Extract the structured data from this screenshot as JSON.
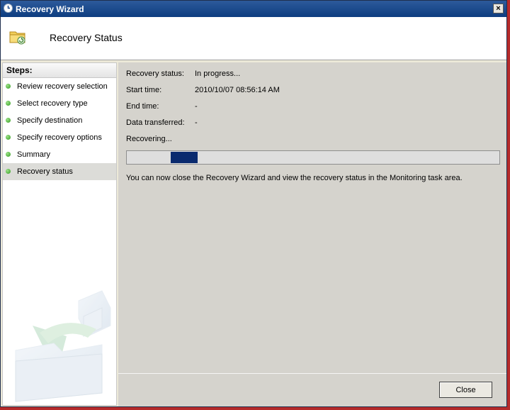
{
  "window": {
    "title": "Recovery Wizard",
    "close_glyph": "×"
  },
  "header": {
    "title": "Recovery Status",
    "icon": "folder-restore-icon"
  },
  "sidebar": {
    "heading": "Steps:",
    "items": [
      {
        "label": "Review recovery selection",
        "status": "complete"
      },
      {
        "label": "Select recovery type",
        "status": "complete"
      },
      {
        "label": "Specify destination",
        "status": "complete"
      },
      {
        "label": "Specify recovery options",
        "status": "complete"
      },
      {
        "label": "Summary",
        "status": "complete"
      },
      {
        "label": "Recovery status",
        "status": "current"
      }
    ]
  },
  "status": {
    "fields": [
      {
        "label": "Recovery status:",
        "value": "In progress..."
      },
      {
        "label": "Start time:",
        "value": "2010/10/07 08:56:14 AM"
      },
      {
        "label": "End time:",
        "value": "-"
      },
      {
        "label": "Data transferred:",
        "value": "-"
      }
    ],
    "progress_label": "Recovering...",
    "progress_mode": "indeterminate",
    "info_text": "You can now close the Recovery Wizard and view the recovery status in the Monitoring task area."
  },
  "footer": {
    "close_label": "Close"
  },
  "colors": {
    "titlebar": "#1d4a8c",
    "progress_marquee": "#0a2a6e",
    "step_dot": "#2f9a1c",
    "panel": "#d5d3cd"
  }
}
